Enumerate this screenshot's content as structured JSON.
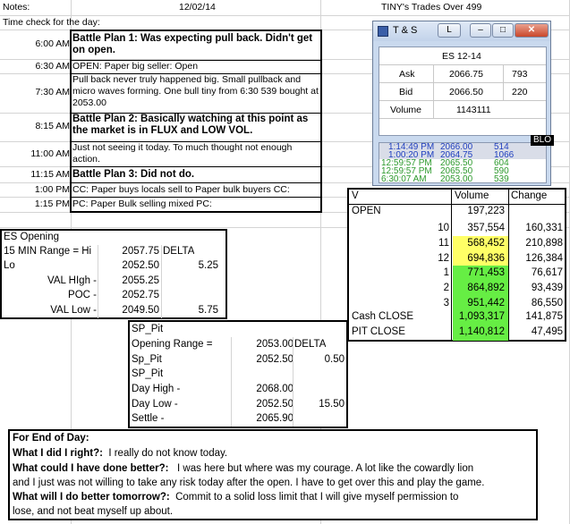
{
  "header": {
    "notes_label": "Notes:",
    "date": "12/02/14",
    "link_title": "TINY's Trades Over 499"
  },
  "time_check": "Time check for the day:",
  "timeline": [
    {
      "time": "6:00 AM",
      "text": "Battle Plan 1: Was expecting pull back. Didn't get on open.",
      "bold": true
    },
    {
      "time": "6:30 AM",
      "text": "OPEN: Paper big seller: Open",
      "bold": false
    },
    {
      "time": "7:30 AM",
      "text": "Pull back never truly happened big.  Small pullback and micro waves forming.  One bull tiny from 6:30 539 bought at 2053.00",
      "bold": false
    },
    {
      "time": "8:15 AM",
      "text": "Battle Plan 2: Basically watching at this point as the market is in FLUX and LOW VOL.",
      "bold": true
    },
    {
      "time": "11:00 AM",
      "text": "Just not seeing it today.  To much thought not enough action.",
      "bold": false
    },
    {
      "time": "11:15 AM",
      "text": "Battle Plan 3: Did not do.",
      "bold": true
    },
    {
      "time": "1:00 PM",
      "text": "CC: Paper buys locals sell to Paper bulk buyers CC:",
      "bold": false
    },
    {
      "time": "1:15 PM",
      "text": "PC: Paper Bulk selling mixed PC:",
      "bold": false
    }
  ],
  "ts_window": {
    "title": "T & S",
    "l_button": "L",
    "symbol": "ES 12-14",
    "ask_label": "Ask",
    "ask_price": "2066.75",
    "ask_size": "793",
    "bid_label": "Bid",
    "bid_price": "2066.50",
    "bid_size": "220",
    "volume_label": "Volume",
    "volume": "1143111",
    "prints": [
      {
        "time": "1:14:49 PM",
        "price": "2066.00",
        "size": "514",
        "color": "#1f3fbf",
        "bg": "#d9dde8"
      },
      {
        "time": "1:00:20 PM",
        "price": "2064.75",
        "size": "1066",
        "color": "#1f3fbf",
        "bg": "#d9dde8"
      },
      {
        "time": "12:59:57 PM",
        "price": "2065.50",
        "size": "604",
        "color": "#2e9a2e",
        "bg": "#ffffff"
      },
      {
        "time": "12:59:57 PM",
        "price": "2065.50",
        "size": "590",
        "color": "#2e9a2e",
        "bg": "#ffffff"
      },
      {
        "time": "6:30:07 AM",
        "price": "2053.00",
        "size": "539",
        "color": "#2e9a2e",
        "bg": "#ffffff"
      }
    ],
    "blo": "BLO"
  },
  "volume_table": {
    "headers": [
      "V",
      "Volume",
      "Change"
    ],
    "open_label": "OPEN",
    "open_volume": "197,223",
    "rows": [
      {
        "label": "10",
        "volume": "357,554",
        "change": "160,331",
        "bg": "#ffffff"
      },
      {
        "label": "11",
        "volume": "568,452",
        "change": "210,898",
        "bg": "#ffff66"
      },
      {
        "label": "12",
        "volume": "694,836",
        "change": "126,384",
        "bg": "#ffff66"
      },
      {
        "label": "1",
        "volume": "771,453",
        "change": "76,617",
        "bg": "#66ee44"
      },
      {
        "label": "2",
        "volume": "864,892",
        "change": "93,439",
        "bg": "#66ee44"
      },
      {
        "label": "3",
        "volume": "951,442",
        "change": "86,550",
        "bg": "#66ee44"
      }
    ],
    "cash_label": "Cash CLOSE",
    "cash_volume": "1,093,317",
    "cash_change": "141,875",
    "pit_label": "PIT CLOSE",
    "pit_volume": "1,140,812",
    "pit_change": "47,495"
  },
  "es_opening": {
    "title": "ES Opening",
    "range_label": "15 MIN Range = Hi",
    "range_hi": "2057.75",
    "delta_label": "DELTA",
    "lo_label": "Lo",
    "lo": "2052.50",
    "delta": "5.25",
    "val_high_label": "VAL HIgh   -",
    "val_high": "2055.25",
    "poc_label": "POC   -",
    "poc": "2052.75",
    "val_low_label": "VAL Low   -",
    "val_low": "2049.50",
    "val_low_delta": "5.75"
  },
  "sp_pit": {
    "title1": "SP_Pit",
    "opening_range_label": "Opening Range =",
    "opening_range": "2053.00",
    "delta_label": "DELTA",
    "sp_pit_label": "Sp_Pit",
    "sp_pit": "2052.50",
    "sp_pit_delta": "0.50",
    "title2": "SP_Pit",
    "day_high_label": "Day High -",
    "day_high": "2068.00",
    "day_low_label": "Day Low -",
    "day_low": "2052.50",
    "day_low_delta": "15.50",
    "settle_label": "Settle -",
    "settle": "2065.90"
  },
  "end_of_day": {
    "title": "For End of Day:",
    "q1": "What I did I right?:",
    "a1": "I really do not know  today.",
    "q2": "What could I have done better?:",
    "a2": "I was here but where was my courage.  A lot like the cowardly lion",
    "a2b": "and I just was not willing to take any risk today after the open.  I have to get over this and play the game.",
    "q3": "What will I do better tomorrow?:",
    "a3": "Commit to a solid loss limit that I will give myself permission to",
    "a3b": "lose, and not beat myself up about."
  }
}
